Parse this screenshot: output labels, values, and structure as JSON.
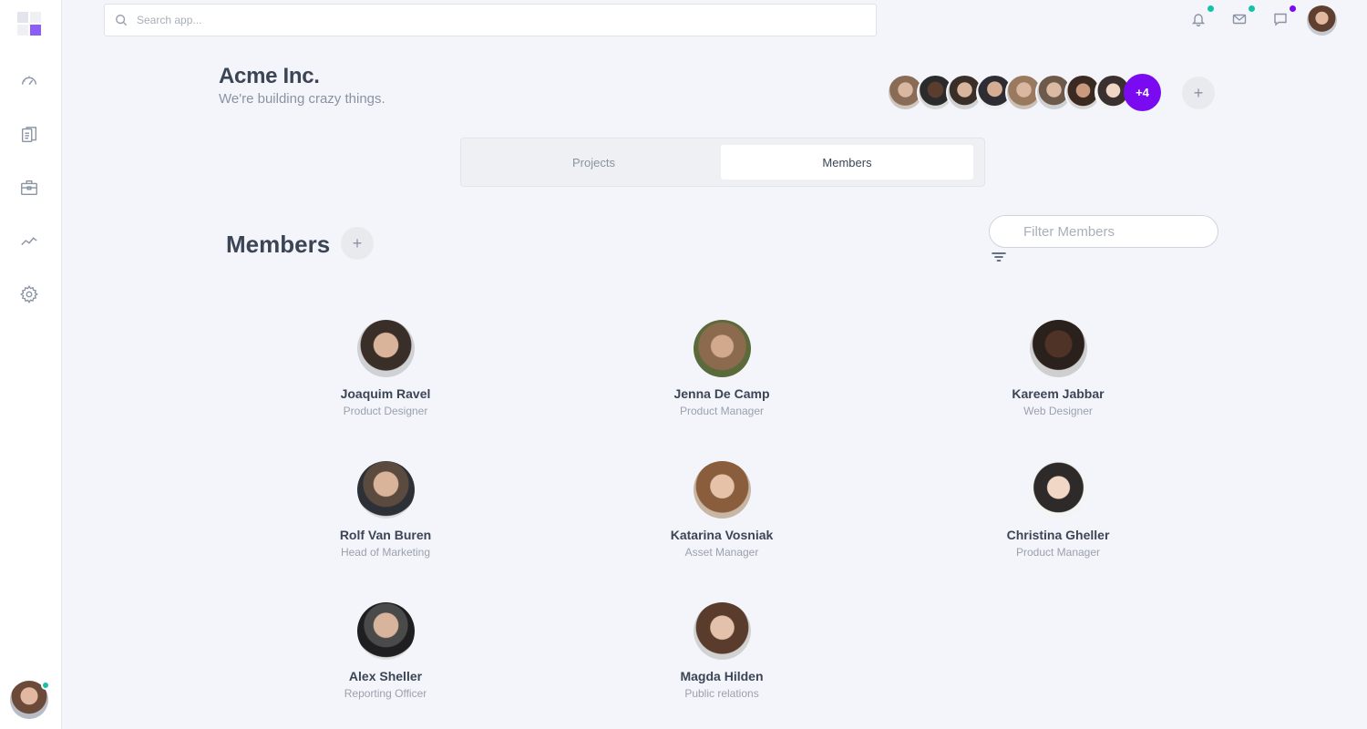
{
  "search": {
    "placeholder": "Search app..."
  },
  "sidebar": {
    "icons": [
      "dashboard-icon",
      "documents-icon",
      "briefcase-icon",
      "analytics-icon",
      "settings-icon"
    ],
    "user_status_color": "#13c2a8"
  },
  "topbar": {
    "notifications": [
      {
        "icon": "bell-icon",
        "dot_color": "#13c2a8"
      },
      {
        "icon": "mail-icon",
        "dot_color": "#13c2a8"
      },
      {
        "icon": "chat-icon",
        "dot_color": "#7a0af0"
      }
    ]
  },
  "company": {
    "name": "Acme Inc.",
    "tagline": "We're building crazy things.",
    "more_members": "+4",
    "add_label": "+"
  },
  "tabs": [
    {
      "label": "Projects",
      "active": false
    },
    {
      "label": "Members",
      "active": true
    }
  ],
  "members_section": {
    "title": "Members",
    "add_label": "+",
    "filter_placeholder": "Filter Members"
  },
  "members": [
    {
      "name": "Joaquim Ravel",
      "role": "Product Designer"
    },
    {
      "name": "Jenna De Camp",
      "role": "Product Manager"
    },
    {
      "name": "Kareem Jabbar",
      "role": "Web Designer"
    },
    {
      "name": "Rolf Van Buren",
      "role": "Head of Marketing"
    },
    {
      "name": "Katarina Vosniak",
      "role": "Asset Manager"
    },
    {
      "name": "Christina Gheller",
      "role": "Product Manager"
    },
    {
      "name": "Alex Sheller",
      "role": "Reporting Officer"
    },
    {
      "name": "Magda Hilden",
      "role": "Public relations"
    }
  ],
  "colors": {
    "accent": "#7a0af0",
    "logo_accent": "#8b5cf6",
    "background": "#f4f5fa",
    "online": "#13c2a8"
  }
}
